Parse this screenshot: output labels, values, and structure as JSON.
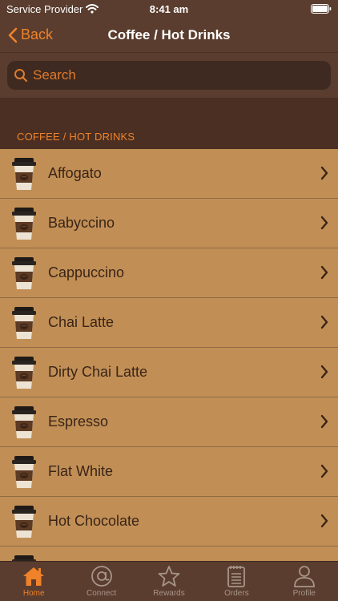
{
  "status_bar": {
    "carrier": "Service Provider",
    "time": "8:41 am"
  },
  "nav": {
    "back_label": "Back",
    "title": "Coffee / Hot Drinks"
  },
  "search": {
    "placeholder": "Search"
  },
  "section": {
    "header": "COFFEE / HOT DRINKS"
  },
  "items": [
    {
      "label": "Affogato"
    },
    {
      "label": "Babyccino"
    },
    {
      "label": "Cappuccino"
    },
    {
      "label": "Chai Latte"
    },
    {
      "label": "Dirty Chai Latte"
    },
    {
      "label": "Espresso"
    },
    {
      "label": "Flat White"
    },
    {
      "label": "Hot Chocolate"
    },
    {
      "label": ""
    }
  ],
  "tabs": [
    {
      "label": "Home",
      "icon": "home-icon"
    },
    {
      "label": "Connect",
      "icon": "at-icon"
    },
    {
      "label": "Rewards",
      "icon": "star-icon"
    },
    {
      "label": "Orders",
      "icon": "notepad-icon"
    },
    {
      "label": "Profile",
      "icon": "person-icon"
    }
  ],
  "colors": {
    "accent": "#f0822a",
    "list_bg": "#c18f55",
    "bar_bg": "#5a3d2e",
    "dark_bg": "#4a2f22"
  }
}
